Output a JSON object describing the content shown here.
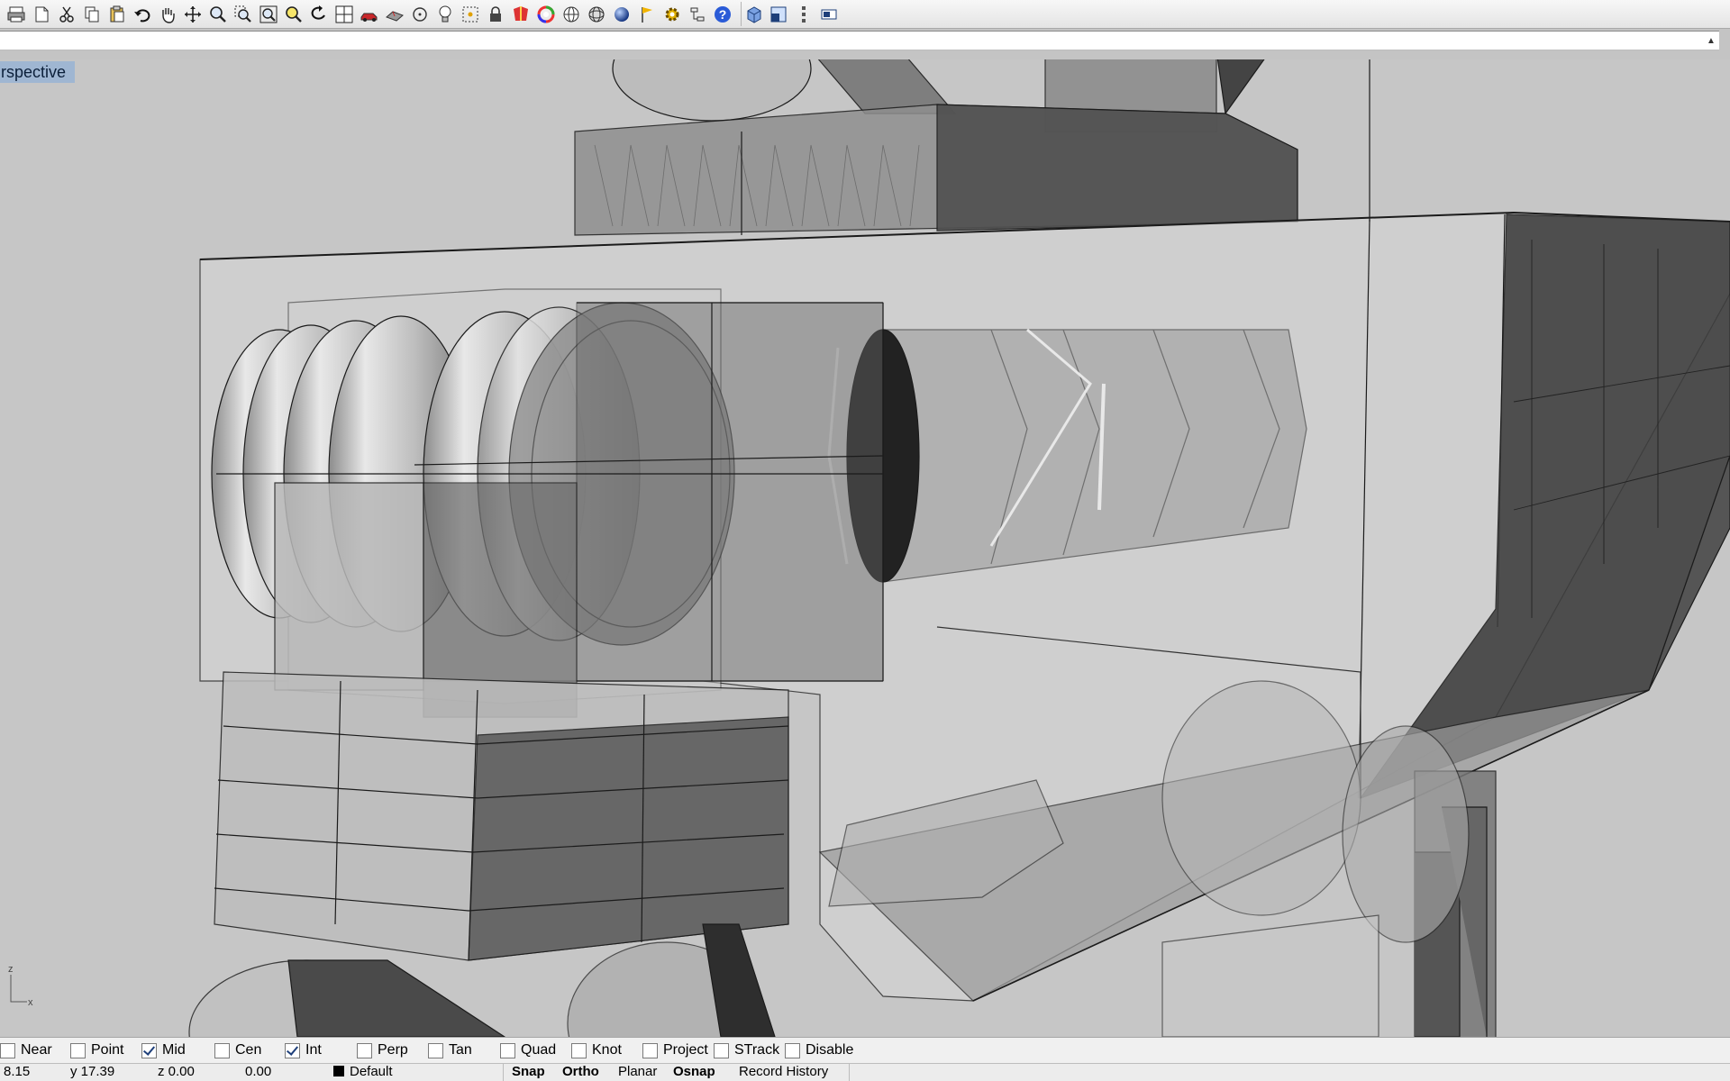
{
  "toolbar": {
    "icons": [
      "print-icon",
      "new-file-icon",
      "cut-icon",
      "copy-icon",
      "paste-icon",
      "undo-icon",
      "pan-icon",
      "rotate-view-icon",
      "zoom-icon",
      "zoom-window-icon",
      "zoom-extents-icon",
      "zoom-selected-icon",
      "undo-view-icon",
      "four-viewports-icon",
      "car-icon",
      "model-icon",
      "circle-icon",
      "light-icon",
      "point-icon",
      "lock-icon",
      "shield-icon",
      "color-wheel-icon",
      "sphere-wire-icon",
      "mesh-sphere-icon",
      "rendered-sphere-icon",
      "flag-icon",
      "settings-gear-icon",
      "tools-icon",
      "help-icon",
      "box-view-icon",
      "viewport-layout-icon",
      "vertical-dots-icon",
      "small-window-icon"
    ]
  },
  "command": {
    "value": "",
    "scroll_icon": "scroll-icon"
  },
  "viewport": {
    "title": "rspective",
    "axis": {
      "z": "z",
      "x": "x"
    }
  },
  "osnap": {
    "items": [
      {
        "label": "Near",
        "checked": false
      },
      {
        "label": "Point",
        "checked": false
      },
      {
        "label": "Mid",
        "checked": true
      },
      {
        "label": "Cen",
        "checked": false
      },
      {
        "label": "Int",
        "checked": true
      },
      {
        "label": "Perp",
        "checked": false
      },
      {
        "label": "Tan",
        "checked": false
      },
      {
        "label": "Quad",
        "checked": false
      },
      {
        "label": "Knot",
        "checked": false
      },
      {
        "label": "Project",
        "checked": false
      },
      {
        "label": "STrack",
        "checked": false
      },
      {
        "label": "Disable",
        "checked": false
      }
    ]
  },
  "status": {
    "x": "8.15",
    "y": "y 17.39",
    "z": "z 0.00",
    "distance": "0.00",
    "layer": "Default",
    "snap": "Snap",
    "ortho": "Ortho",
    "planar": "Planar",
    "osnap": "Osnap",
    "history": "Record History"
  },
  "colors": {
    "viewport_bg": "#c6c6c6",
    "title_bg": "#9fb6d2",
    "toolbar_bg": "#ececec"
  }
}
